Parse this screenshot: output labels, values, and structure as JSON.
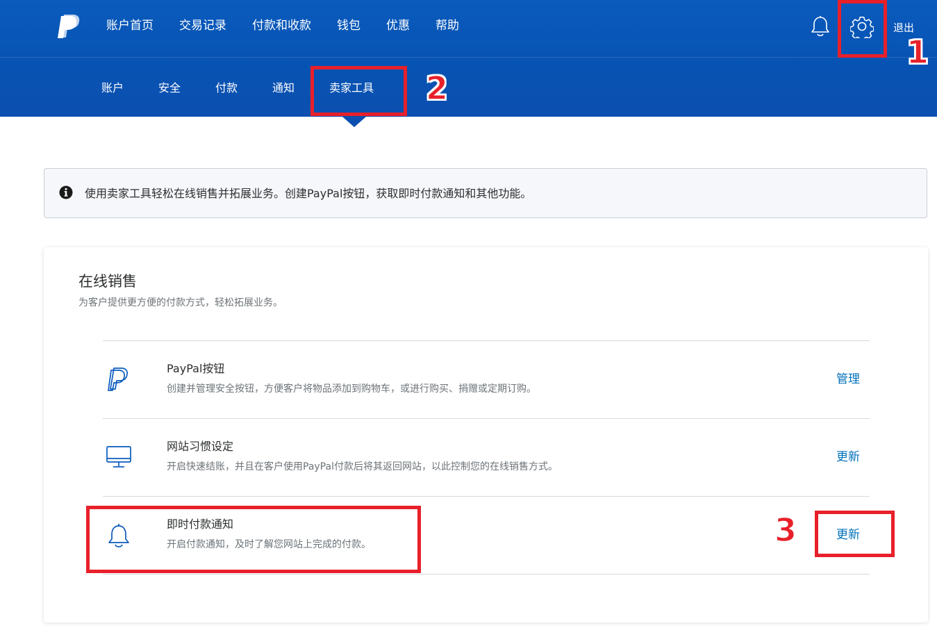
{
  "header": {
    "nav": [
      "账户首页",
      "交易记录",
      "付款和收款",
      "钱包",
      "优惠",
      "帮助"
    ],
    "logout_label": "退出",
    "subnav": [
      "账户",
      "安全",
      "付款",
      "通知",
      "卖家工具"
    ],
    "active_subnav": "卖家工具"
  },
  "info_banner": {
    "text": "使用卖家工具轻松在线销售并拓展业务。创建PayPal按钮，获取即时付款通知和其他功能。"
  },
  "section": {
    "title": "在线销售",
    "subtitle": "为客户提供更方便的付款方式，轻松拓展业务。",
    "rows": [
      {
        "icon": "paypal-icon",
        "title": "PayPal按钮",
        "description": "创建并管理安全按钮，方便客户将物品添加到购物车，或进行购买、捐赠或定期订购。",
        "action": "管理"
      },
      {
        "icon": "monitor-icon",
        "title": "网站习惯设定",
        "description": "开启快速结账，并且在客户使用PayPal付款后将其返回网站，以此控制您的在线销售方式。",
        "action": "更新"
      },
      {
        "icon": "bell-icon",
        "title": "即时付款通知",
        "description": "开启付款通知，及时了解您网站上完成的付款。",
        "action": "更新"
      }
    ]
  },
  "annotations": {
    "step1": "1",
    "step2": "2",
    "step3": "3",
    "color": "#e8202a"
  },
  "colors": {
    "header_blue": "#0753b3",
    "link_blue": "#0070ba"
  }
}
